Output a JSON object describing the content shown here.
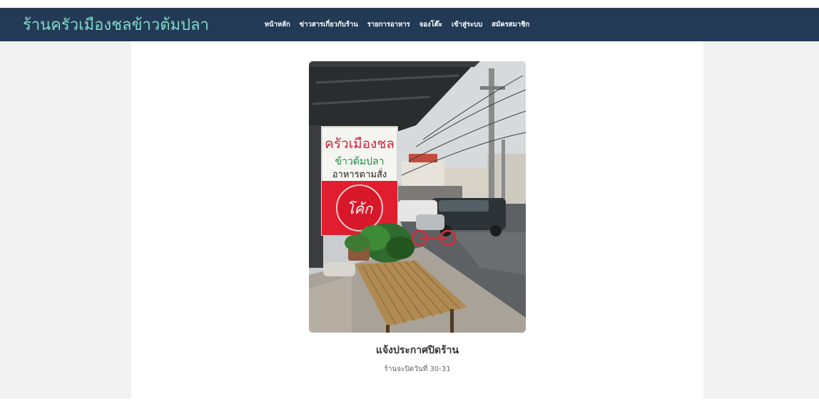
{
  "site": {
    "brand": "ร้านครัวเมืองชลข้าวต้มปลา"
  },
  "nav": {
    "items": [
      {
        "label": "หน้าหลัก"
      },
      {
        "label": "ข่าวสารเกี่ยวกับร้าน"
      },
      {
        "label": "รายการอาหาร"
      },
      {
        "label": "จองโต๊ะ"
      },
      {
        "label": "เข้าสู่ระบบ"
      },
      {
        "label": "สมัครสมาชิก"
      }
    ]
  },
  "post": {
    "title": "แจ้งประกาศปิดร้าน",
    "subtitle": "ร้านจะปิดวันที่ 30-31",
    "photo": {
      "sign_line1": "ครัวเมืองชล",
      "sign_line2": "ข้าวต้มปลา",
      "sign_line3": "อาหารตามสั่ง",
      "sign_logo": "โค้ก"
    }
  },
  "colors": {
    "navbar": "#233a56",
    "brand": "#7fd9c9",
    "page_bg": "#f2f2f2",
    "content_bg": "#ffffff"
  }
}
